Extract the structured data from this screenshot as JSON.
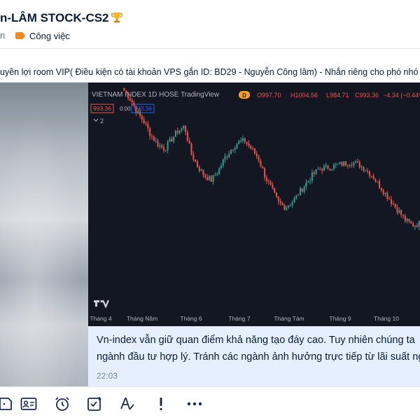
{
  "header": {
    "title": "n-LÂM STOCK-CS2",
    "subtitle_fragment": "n",
    "tag_label": "Công việc",
    "tag_color": "#f08a24"
  },
  "pinned": {
    "text": "uyền lợi room VIP( Điều kiện có tài khoản VPS gắn ID: BD29 - Nguyễn Công lâm) - Nhắn riêng cho phó nhó"
  },
  "chart": {
    "header_text": "VIETNAM INDEX  1D  HOSE  TradingView",
    "badge": "D",
    "ohlc": {
      "o": "O997.70",
      "h": "H1004.56",
      "l": "L984.71",
      "c": "C993.36",
      "change": "−4.34 (−0.44%)"
    },
    "price_box_1": "993.36",
    "price_mid": "0.00",
    "price_box_2": "993.36",
    "indicator_count": "2",
    "tv_logo_text": "TV",
    "colors": {
      "up": "#26a69a",
      "down": "#ef5350",
      "bg": "#131722",
      "text": "#b2b5be"
    },
    "x_labels": [
      "Tháng 4",
      "Tháng Năm",
      "Tháng 6",
      "Tháng 7",
      "Tháng Tám",
      "Tháng 9",
      "Tháng 10"
    ]
  },
  "chart_data": {
    "type": "candlestick",
    "title": "VIETNAM INDEX",
    "interval": "1D",
    "exchange": "HOSE",
    "x_categories": [
      "Tháng 4",
      "Tháng Năm",
      "Tháng 6",
      "Tháng 7",
      "Tháng Tám",
      "Tháng 9",
      "Tháng 10"
    ],
    "last": {
      "open": 997.7,
      "high": 1004.56,
      "low": 984.71,
      "close": 993.36,
      "change": -4.34,
      "change_pct": -0.44
    },
    "approx_close_path": [
      1290,
      1270,
      1240,
      1220,
      1190,
      1170,
      1160,
      1180,
      1200,
      1210,
      1150,
      1120,
      1100,
      1090,
      1110,
      1140,
      1160,
      1175,
      1178,
      1160,
      1140,
      1100,
      1070,
      1040,
      1030,
      1040,
      1060,
      1080,
      1100,
      1115,
      1118,
      1120,
      1125,
      1128,
      1130,
      1125,
      1115,
      1100,
      1080,
      1060,
      1040,
      1020,
      1000,
      990,
      993
    ]
  },
  "message": {
    "line1": "Vn-index vẫn giữ quan điểm khả năng tạo đáy cao. Tuy nhiên chúng ta",
    "line2": "ngành đầu tư hợp lý. Tránh các ngành ảnh hưởng trực tiếp từ lãi suất ng",
    "time": "22:03"
  },
  "toolbar": {
    "icons": [
      "sticker-icon",
      "contact-card-icon",
      "alarm-clock-icon",
      "task-check-icon",
      "text-format-icon",
      "important-icon",
      "more-icon"
    ]
  }
}
